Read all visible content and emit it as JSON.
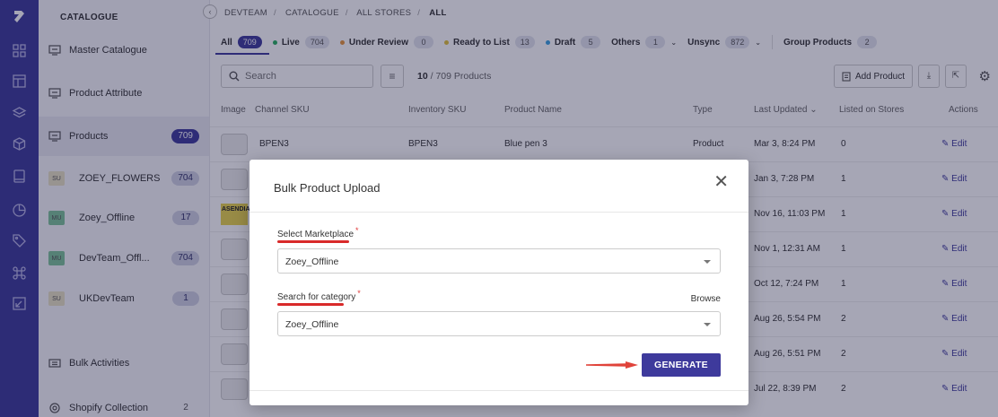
{
  "breadcrumb": [
    "DEVTEAM",
    "CATALOGUE",
    "ALL STORES",
    "ALL"
  ],
  "sidebar": {
    "title": "CATALOGUE",
    "nav": [
      {
        "label": "Master Catalogue"
      },
      {
        "label": "Product Attribute"
      },
      {
        "label": "Products",
        "count": "709"
      }
    ],
    "stores": [
      {
        "badge": "SU",
        "label": "ZOEY_FLOWERS",
        "count": "704",
        "color": "#e9e2c4"
      },
      {
        "badge": "MU",
        "label": "Zoey_Offline",
        "count": "17",
        "color": "#7fc49a"
      },
      {
        "badge": "MU",
        "label": "DevTeam_Offl...",
        "count": "704",
        "color": "#7fc49a"
      },
      {
        "badge": "SU",
        "label": "UKDevTeam",
        "count": "1",
        "color": "#e9e2c4"
      }
    ],
    "bottom": [
      {
        "label": "Bulk Activities"
      },
      {
        "label": "Shopify Collection",
        "count": "2"
      }
    ]
  },
  "filters": [
    {
      "label": "All",
      "count": "709",
      "dot": ""
    },
    {
      "label": "Live",
      "count": "704",
      "dot": "#27ae60"
    },
    {
      "label": "Under Review",
      "count": "0",
      "dot": "#e8963a"
    },
    {
      "label": "Ready to List",
      "count": "13",
      "dot": "#e0c03a"
    },
    {
      "label": "Draft",
      "count": "5",
      "dot": "#3aa0e0"
    },
    {
      "label": "Others",
      "count": "1",
      "dot": ""
    },
    {
      "label": "Unsync",
      "count": "872",
      "dot": ""
    },
    {
      "label": "Group Products",
      "count": "2",
      "dot": ""
    }
  ],
  "toolbar": {
    "search_placeholder": "Search",
    "count_shown": "10",
    "count_total": "/ 709 Products",
    "add_label": "Add Product"
  },
  "table": {
    "headers": [
      "Image",
      "Channel SKU",
      "Inventory SKU",
      "Product Name",
      "Type",
      "Last Updated",
      "Listed on Stores",
      "Actions"
    ],
    "rows": [
      {
        "channel_sku": "BPEN3",
        "inventory_sku": "BPEN3",
        "name": "Blue pen 3",
        "type": "Product",
        "updated": "Mar 3, 8:24 PM",
        "listed": "0",
        "action": "Edit"
      },
      {
        "channel_sku": "",
        "inventory_sku": "",
        "name": "",
        "type": "",
        "updated": "Jan 3, 7:28 PM",
        "listed": "1",
        "action": "Edit"
      },
      {
        "channel_sku": "",
        "inventory_sku": "",
        "name": "",
        "type": "",
        "updated": "Nov 16, 11:03 PM",
        "listed": "1",
        "action": "Edit",
        "asendia": "ASENDIA"
      },
      {
        "channel_sku": "",
        "inventory_sku": "",
        "name": "",
        "type": "",
        "updated": "Nov 1, 12:31 AM",
        "listed": "1",
        "action": "Edit"
      },
      {
        "channel_sku": "",
        "inventory_sku": "",
        "name": "",
        "type": "",
        "updated": "Oct 12, 7:24 PM",
        "listed": "1",
        "action": "Edit"
      },
      {
        "channel_sku": "",
        "inventory_sku": "",
        "name": "",
        "type": "",
        "updated": "Aug 26, 5:54 PM",
        "listed": "2",
        "action": "Edit"
      },
      {
        "channel_sku": "",
        "inventory_sku": "",
        "name": "",
        "type": "",
        "updated": "Aug 26, 5:51 PM",
        "listed": "2",
        "action": "Edit"
      },
      {
        "channel_sku": "",
        "inventory_sku": "",
        "name": "",
        "type": "",
        "updated": "Jul 22, 8:39 PM",
        "listed": "2",
        "action": "Edit"
      }
    ]
  },
  "modal": {
    "title": "Bulk Product Upload",
    "marketplace_label": "Select Marketplace",
    "marketplace_value": "Zoey_Offline",
    "category_label": "Search for category",
    "category_value": "Zoey_Offline",
    "browse_label": "Browse",
    "generate_label": "GENERATE",
    "required_mark": "*"
  },
  "colors": {
    "primary": "#3e3a9c",
    "rail": "#3d3a9a",
    "annotation": "#d92a2a"
  }
}
